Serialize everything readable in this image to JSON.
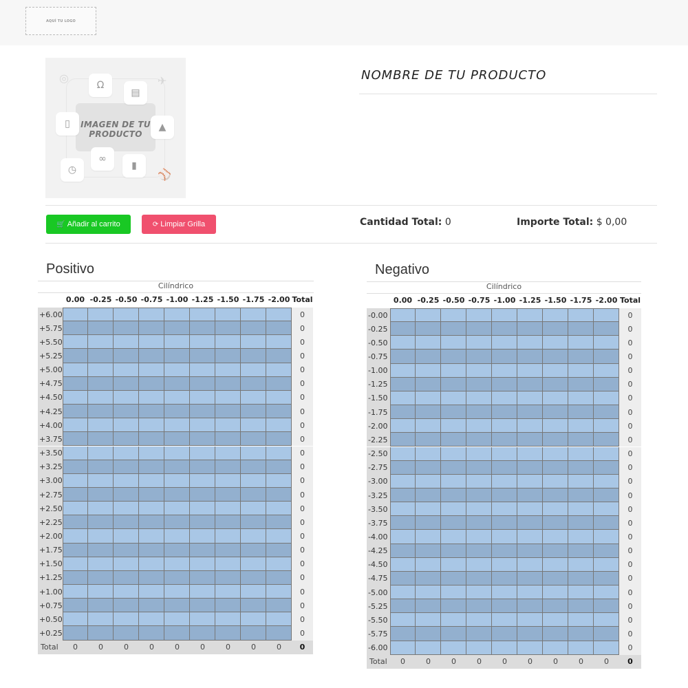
{
  "header": {
    "logo_text": "AQUÍ TU LOGO"
  },
  "product": {
    "image_text_line1": "IMAGEN DE TU",
    "image_text_line2": "PRODUCTO",
    "title": "NOMBRE DE TU PRODUCTO"
  },
  "actions": {
    "add_to_cart_label": "Añadir al carrito",
    "clear_grid_label": "Limpiar Grilla",
    "add_to_cart_color": "#19c824",
    "clear_grid_color": "#f0506e"
  },
  "summary": {
    "quantity_label": "Cantidad Total:",
    "quantity_value": "0",
    "amount_label": "Importe Total:",
    "amount_value": "$ 0,00"
  },
  "colors": {
    "cell_light": "#a9c7e6",
    "cell_dark": "#93b0cf",
    "row_label_bg": "#dcdcdc"
  },
  "grids": [
    {
      "title": "Positivo",
      "cylinder_label": "Cilíndrico",
      "columns": [
        "0.00",
        "-0.25",
        "-0.50",
        "-0.75",
        "-1.00",
        "-1.25",
        "-1.50",
        "-1.75",
        "-2.00",
        "Total"
      ],
      "rows": [
        "+6.00",
        "+5.75",
        "+5.50",
        "+5.25",
        "+5.00",
        "+4.75",
        "+4.50",
        "+4.25",
        "+4.00",
        "+3.75",
        "+3.50",
        "+3.25",
        "+3.00",
        "+2.75",
        "+2.50",
        "+2.25",
        "+2.00",
        "+1.75",
        "+1.50",
        "+1.25",
        "+1.00",
        "+0.75",
        "+0.50",
        "+0.25"
      ],
      "row_totals": [
        "0",
        "0",
        "0",
        "0",
        "0",
        "0",
        "0",
        "0",
        "0",
        "0",
        "0",
        "0",
        "0",
        "0",
        "0",
        "0",
        "0",
        "0",
        "0",
        "0",
        "0",
        "0",
        "0",
        "0"
      ],
      "footer_label": "Total",
      "footer_values": [
        "0",
        "0",
        "0",
        "0",
        "0",
        "0",
        "0",
        "0",
        "0"
      ],
      "grand_total": "0"
    },
    {
      "title": "Negativo",
      "cylinder_label": "Cilíndrico",
      "columns": [
        "0.00",
        "-0.25",
        "-0.50",
        "-0.75",
        "-1.00",
        "-1.25",
        "-1.50",
        "-1.75",
        "-2.00",
        "Total"
      ],
      "rows": [
        "-0.00",
        "-0.25",
        "-0.50",
        "-0.75",
        "-1.00",
        "-1.25",
        "-1.50",
        "-1.75",
        "-2.00",
        "-2.25",
        "-2.50",
        "-2.75",
        "-3.00",
        "-3.25",
        "-3.50",
        "-3.75",
        "-4.00",
        "-4.25",
        "-4.50",
        "-4.75",
        "-5.00",
        "-5.25",
        "-5.50",
        "-5.75",
        "-6.00"
      ],
      "row_totals": [
        "0",
        "0",
        "0",
        "0",
        "0",
        "0",
        "0",
        "0",
        "0",
        "0",
        "0",
        "0",
        "0",
        "0",
        "0",
        "0",
        "0",
        "0",
        "0",
        "0",
        "0",
        "0",
        "0",
        "0",
        "0"
      ],
      "footer_label": "Total",
      "footer_values": [
        "0",
        "0",
        "0",
        "0",
        "0",
        "0",
        "0",
        "0",
        "0"
      ],
      "grand_total": "0"
    }
  ]
}
